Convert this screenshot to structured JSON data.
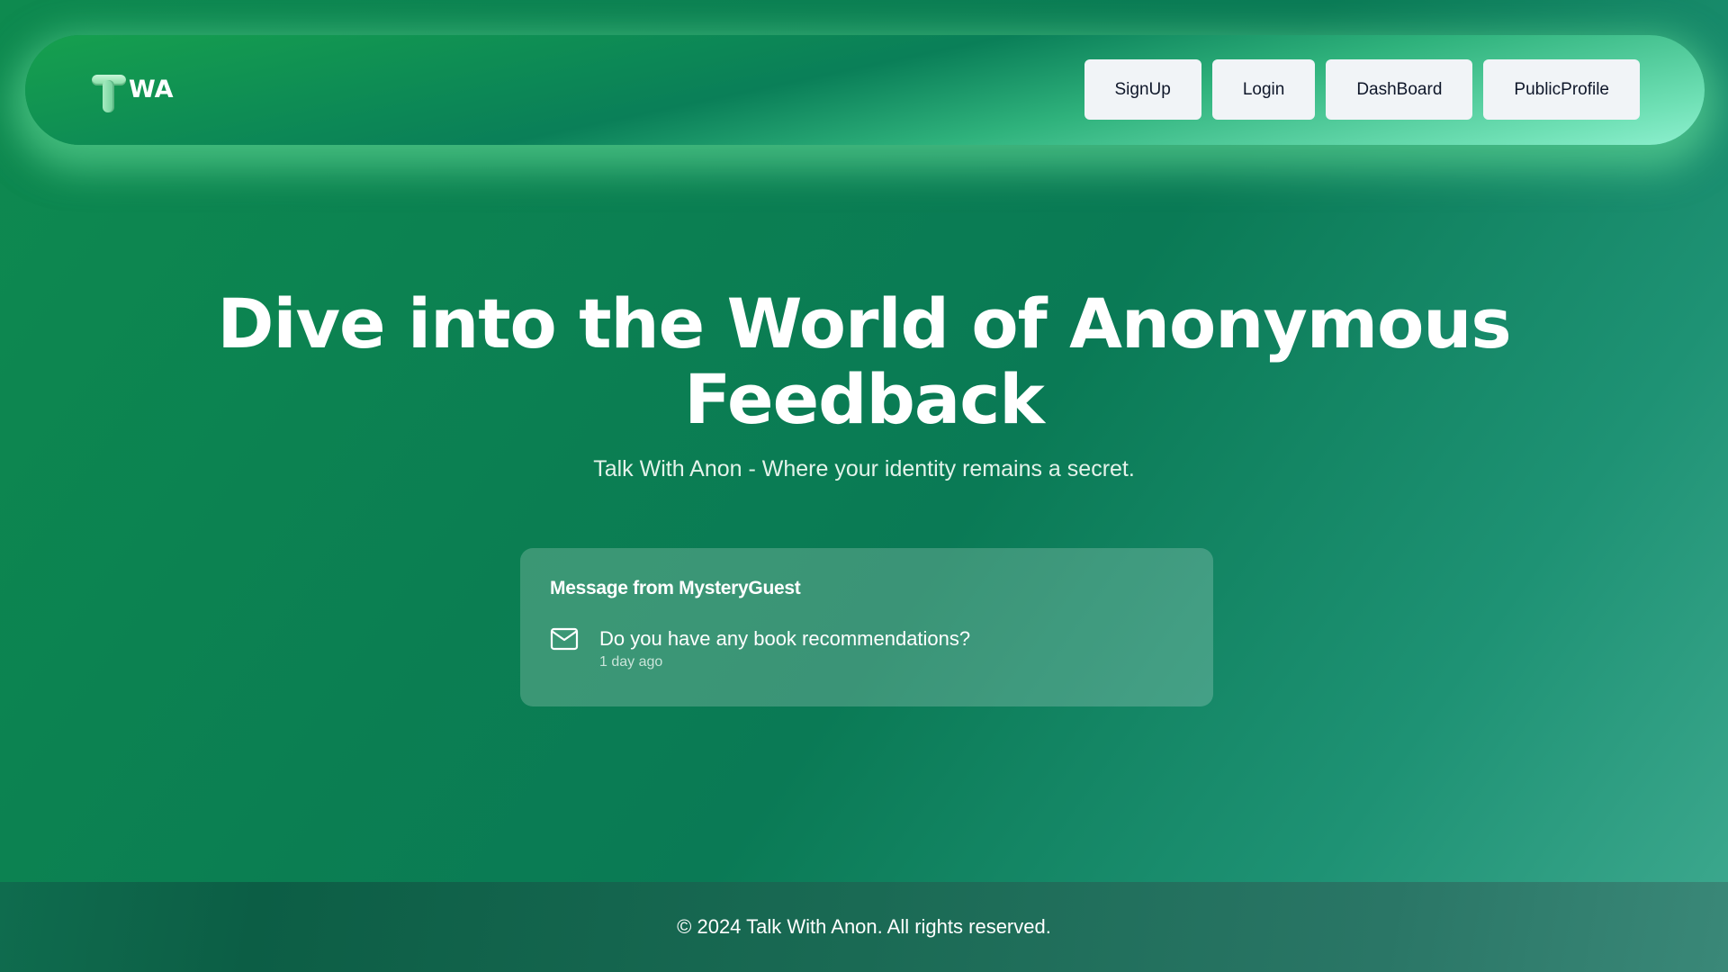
{
  "logo": {
    "letter": "T",
    "text": "WA",
    "icon": "t-letter-logo-icon"
  },
  "nav": {
    "items": [
      {
        "label": "SignUp"
      },
      {
        "label": "Login"
      },
      {
        "label": "DashBoard"
      },
      {
        "label": "PublicProfile"
      }
    ]
  },
  "hero": {
    "title": "Dive into the World of Anonymous Feedback",
    "subtitle": "Talk With Anon - Where your identity remains a secret."
  },
  "message_card": {
    "title": "Message from MysteryGuest",
    "icon": "mail-icon",
    "message": "Do you have any book recommendations?",
    "time": "1 day ago"
  },
  "footer": {
    "text": "© 2024 Talk With Anon. All rights reserved."
  },
  "colors": {
    "background_start": "#0e8a4f",
    "background_end": "#3faa90",
    "nav_button_bg": "#f1f4f7",
    "text_primary": "#ffffff"
  }
}
